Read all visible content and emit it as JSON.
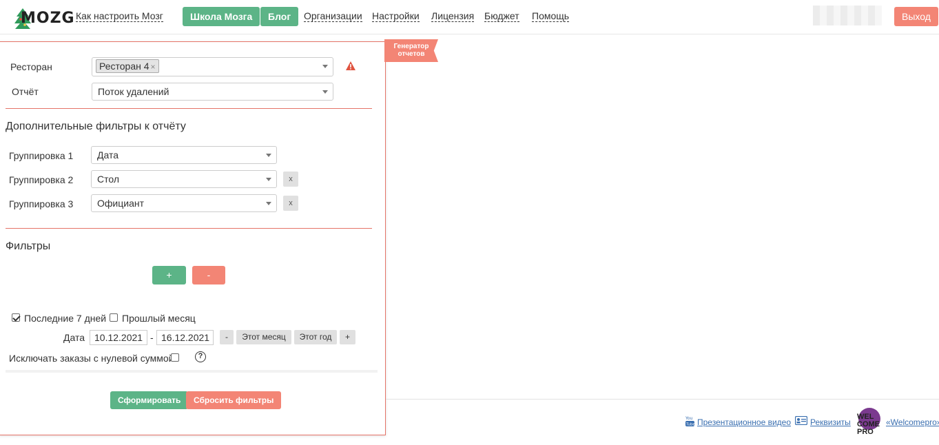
{
  "nav": {
    "logo": "MOZG",
    "how_to": "Как настроить Мозг",
    "school": "Школа Мозга",
    "blog": "Блог",
    "orgs": "Организации",
    "settings": "Настройки",
    "license": "Лицензия",
    "budget": "Бюджет",
    "help": "Помощь",
    "logout": "Выход"
  },
  "ribbon": {
    "line1": "Генератор",
    "line2": "отчетов"
  },
  "form": {
    "restaurant_label": "Ресторан",
    "restaurant_tag": "Ресторан 4",
    "report_label": "Отчёт",
    "report_value": "Поток удалений",
    "extra_filters_title": "Дополнительные фильтры к отчёту",
    "groupings": [
      {
        "label": "Группировка 1",
        "value": "Дата"
      },
      {
        "label": "Группировка 2",
        "value": "Стол"
      },
      {
        "label": "Группировка 3",
        "value": "Официант"
      }
    ],
    "filters_title": "Фильтры",
    "plus": "+",
    "minus": "-",
    "last7_label": "Последние 7 дней",
    "last7_checked": true,
    "last_month_label": "Прошлый месяц",
    "date_label": "Дата",
    "date_from": "10.12.2021",
    "date_to": "16.12.2021",
    "date_sep": "-",
    "btn_prev": "-",
    "btn_this_month": "Этот месяц",
    "btn_this_year": "Этот год",
    "btn_next": "+",
    "exclude_zero_label": "Исключать заказы с нулевой суммой",
    "help": "?",
    "submit": "Сформировать",
    "reset": "Сбросить фильтры"
  },
  "footer": {
    "video": "Презентационное видео",
    "requisites": "Реквизиты",
    "welcomepro_logo": "WEL COME PRO",
    "welcomepro": "«Welcomepro»"
  },
  "colors": {
    "green": "#5cb487",
    "red": "#f38575",
    "border_red": "#e57367",
    "link": "#3a6fb0"
  }
}
